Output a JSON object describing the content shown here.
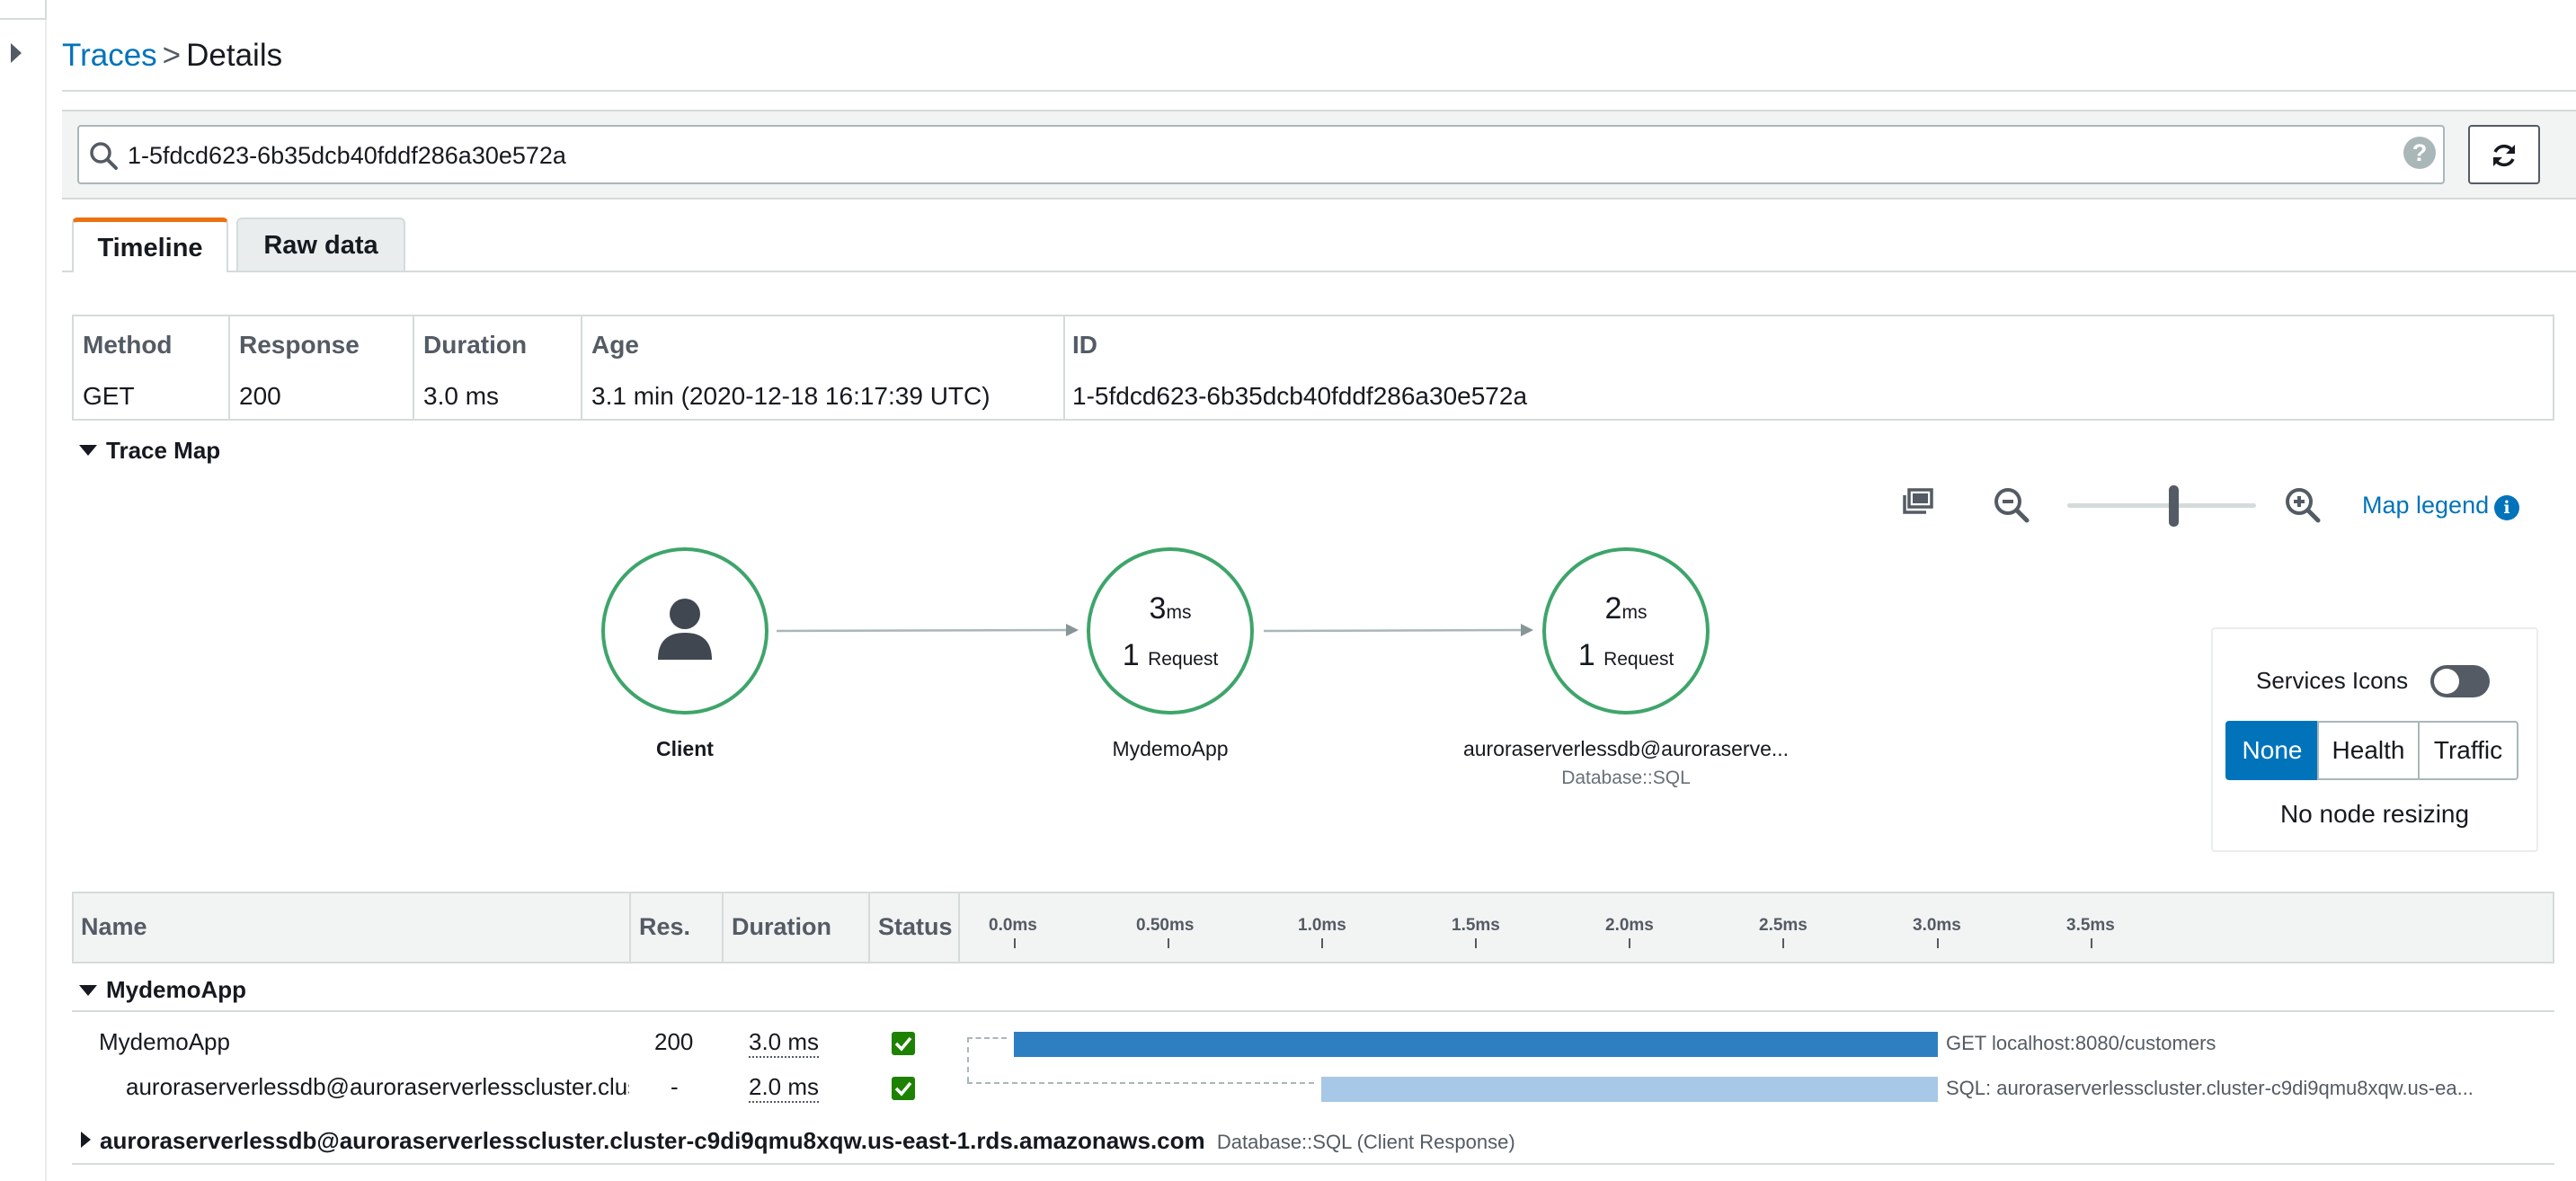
{
  "breadcrumb": {
    "parent": "Traces",
    "separator": ">",
    "current": "Details"
  },
  "search": {
    "value": "1-5fdcd623-6b35dcb40fddf286a30e572a",
    "help": "?"
  },
  "tabs": [
    {
      "label": "Timeline",
      "active": true
    },
    {
      "label": "Raw data",
      "active": false
    }
  ],
  "summary": {
    "headers": [
      "Method",
      "Response",
      "Duration",
      "Age",
      "ID"
    ],
    "values": [
      "GET",
      "200",
      "3.0 ms",
      "3.1 min (2020-12-18 16:17:39 UTC)",
      "1-5fdcd623-6b35dcb40fddf286a30e572a"
    ]
  },
  "trace_map": {
    "title": "Trace Map",
    "nodes": [
      {
        "name": "Client",
        "icon": "user-icon"
      },
      {
        "name": "MydemoApp",
        "latency_value": "3",
        "latency_unit": "ms",
        "requests_value": "1",
        "requests_unit": "Request"
      },
      {
        "name": "auroraserverlessdb@auroraserve...",
        "type": "Database::SQL",
        "latency_value": "2",
        "latency_unit": "ms",
        "requests_value": "1",
        "requests_unit": "Request"
      }
    ],
    "toolbar": {
      "legend_link": "Map legend",
      "zoom_level": 0.6
    },
    "panel": {
      "services_icons_label": "Services Icons",
      "services_icons_on": false,
      "options": [
        "None",
        "Health",
        "Traffic"
      ],
      "selected": "None",
      "footer": "No node resizing"
    }
  },
  "segments": {
    "headers": {
      "name": "Name",
      "res": "Res.",
      "duration": "Duration",
      "status": "Status"
    },
    "ticks": [
      "0.0ms",
      "0.50ms",
      "1.0ms",
      "1.5ms",
      "2.0ms",
      "2.5ms",
      "3.0ms",
      "3.5ms"
    ],
    "groups": [
      {
        "title": "MydemoApp",
        "expanded": true,
        "rows": [
          {
            "name": "MydemoApp",
            "res": "200",
            "duration": "3.0 ms",
            "status": "ok",
            "label": "GET localhost:8080/customers"
          },
          {
            "name": "auroraserverlessdb@auroraserverlesscluster.clus",
            "res": "-",
            "duration": "2.0 ms",
            "status": "ok",
            "label": "SQL: auroraserverlesscluster.cluster-c9di9qmu8xqw.us-ea..."
          }
        ]
      },
      {
        "title": "auroraserverlessdb@auroraserverlesscluster.cluster-c9di9qmu8xqw.us-east-1.rds.amazonaws.com",
        "subtitle": "Database::SQL (Client Response)",
        "expanded": false
      }
    ]
  }
}
